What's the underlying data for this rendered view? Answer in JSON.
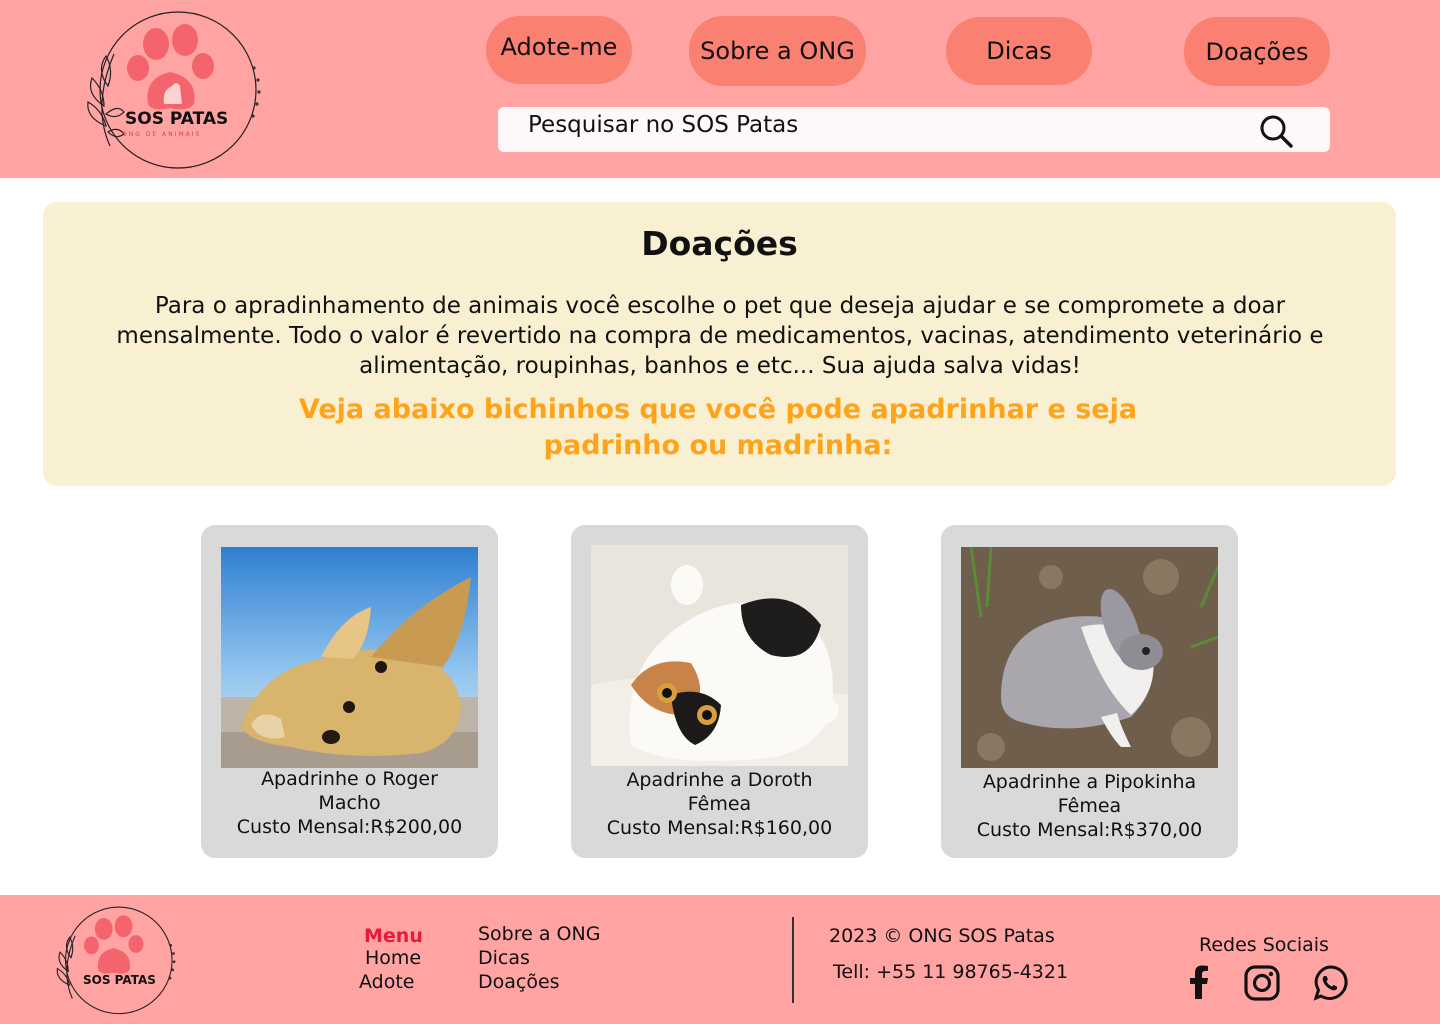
{
  "brand": {
    "name": "SOS PATAS",
    "tagline": "ONG DE ANIMAIS"
  },
  "nav": {
    "items": [
      {
        "label": "Adote-me"
      },
      {
        "label": "Sobre a ONG"
      },
      {
        "label": "Dicas"
      },
      {
        "label": "Doações"
      }
    ]
  },
  "search": {
    "placeholder": "Pesquisar no SOS Patas",
    "icon": "search-icon"
  },
  "donations": {
    "title": "Doações",
    "description": "Para o apradinhamento de animais você escolhe o pet que deseja ajudar e se compromete a doar mensalmente. Todo o valor é revertido na compra de medicamentos, vacinas, atendimento veterinário e alimentação, roupinhas, banhos e etc... Sua ajuda salva vidas!",
    "highlight": "Veja abaixo bichinhos que você pode apadrinhar e seja padrinho ou madrinha:"
  },
  "pets": [
    {
      "title": "Apadrinhe o Roger",
      "sex": "Macho",
      "cost": "Custo Mensal:R$200,00",
      "photo": "dog-photo"
    },
    {
      "title": "Apadrinhe a Doroth",
      "sex": "Fêmea",
      "cost": "Custo Mensal:R$160,00",
      "photo": "cat-photo"
    },
    {
      "title": "Apadrinhe a Pipokinha",
      "sex": "Fêmea",
      "cost": "Custo Mensal:R$370,00",
      "photo": "rabbit-photo"
    }
  ],
  "footer": {
    "menu_title": "Menu",
    "links": {
      "home": "Home",
      "adote": "Adote",
      "sobre": "Sobre a ONG",
      "dicas": "Dicas",
      "doacoes": "Doações"
    },
    "copyright": "2023 © ONG SOS Patas",
    "phone": "Tell: +55 11 98765-4321",
    "social_title": "Redes Sociais",
    "social": [
      "facebook-icon",
      "instagram-icon",
      "whatsapp-icon"
    ]
  },
  "colors": {
    "header_bg": "#ffa3a3",
    "nav_button": "#fa8072",
    "panel_bg": "#f9f0d2",
    "highlight": "#ffa31a",
    "card_bg": "#d9d9d9",
    "menu_title": "#e8193c"
  }
}
